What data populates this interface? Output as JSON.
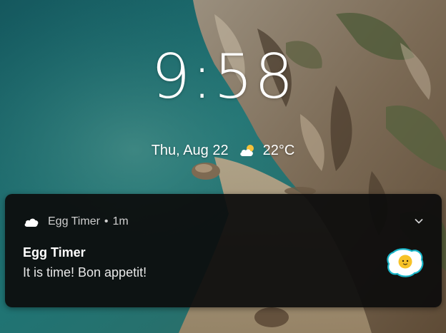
{
  "lockscreen": {
    "time": "9:58",
    "date": "Thu, Aug 22",
    "temperature": "22°C",
    "weather_icon": "partly-cloudy-icon"
  },
  "notification": {
    "app_name": "Egg Timer",
    "separator": "•",
    "age": "1m",
    "title": "Egg Timer",
    "text": "It is time! Bon appetit!",
    "small_icon": "cloud-icon",
    "large_icon": "fried-egg-icon",
    "expand_icon": "chevron-down-icon"
  },
  "colors": {
    "card_background": "#0c0c0c",
    "text_primary": "#ffffff",
    "text_secondary": "#cfcfcf",
    "egg_yolk": "#f7c227",
    "egg_outline": "#19b6c9"
  }
}
